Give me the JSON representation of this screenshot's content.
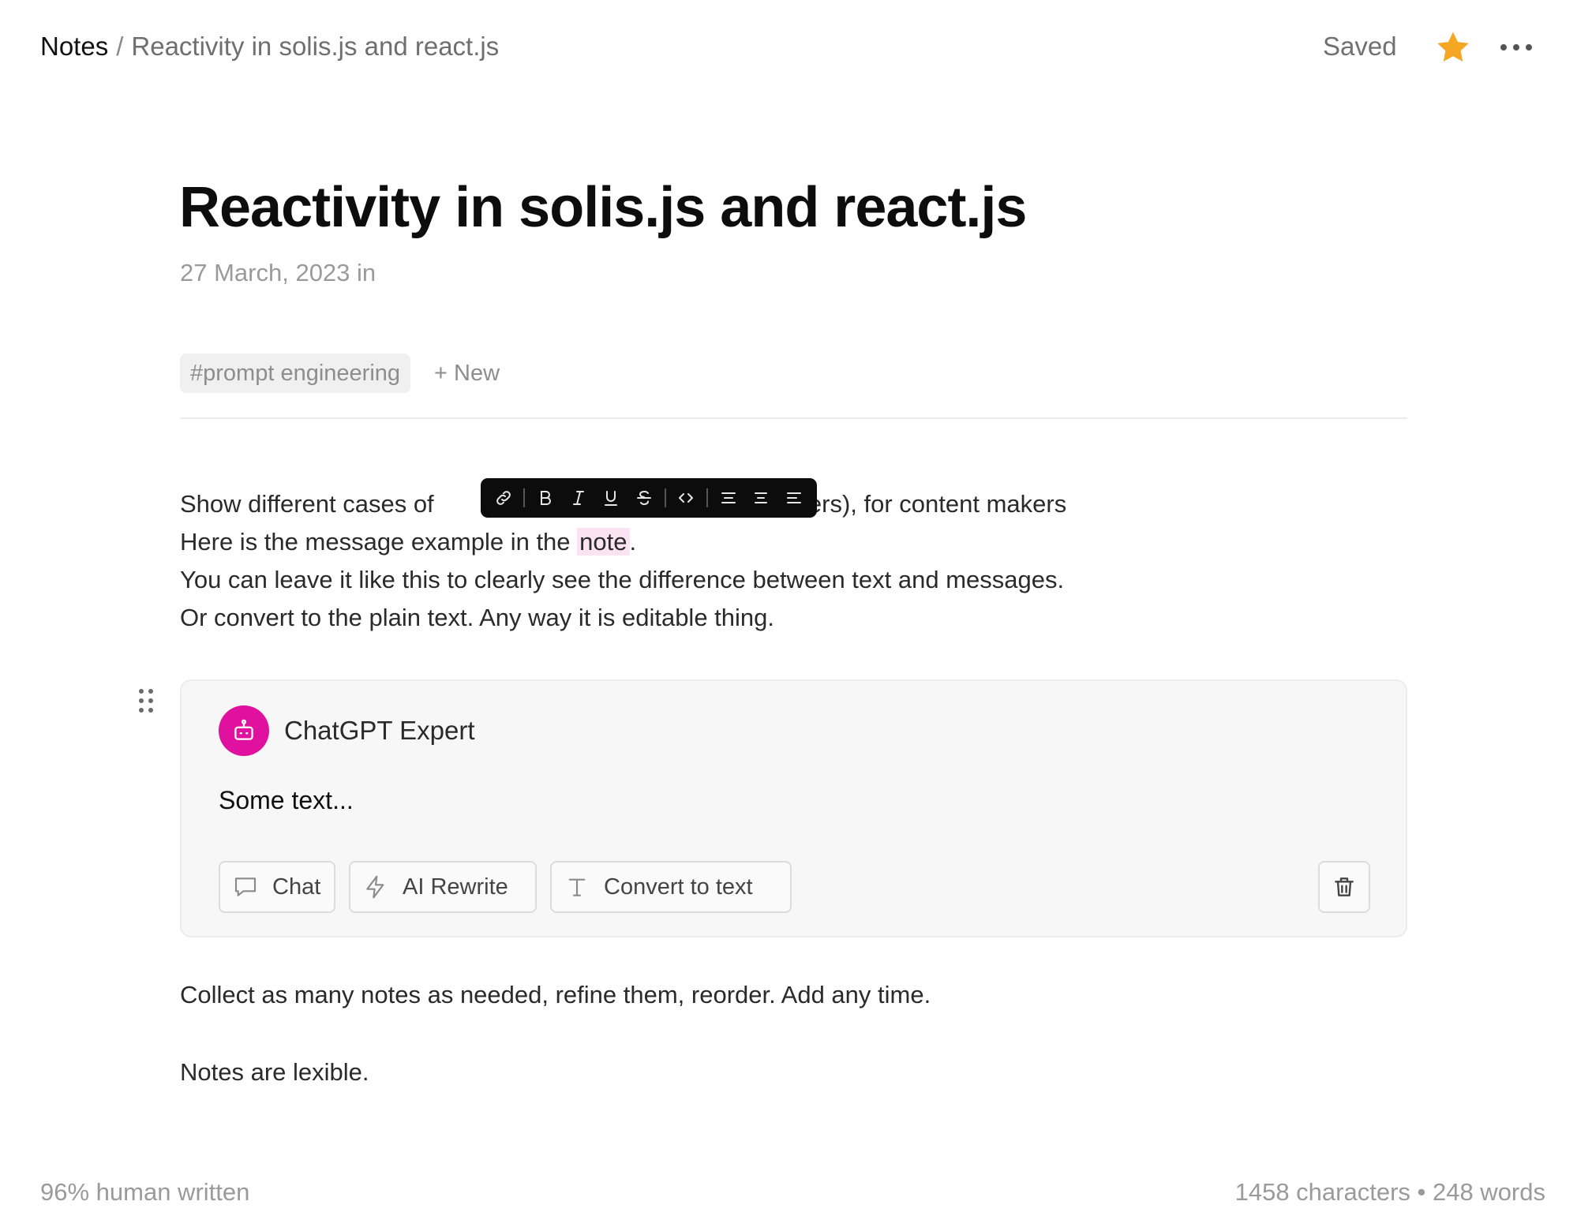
{
  "breadcrumb": {
    "root": "Notes",
    "separator": "/",
    "current": "Reactivity in solis.js and react.js"
  },
  "header": {
    "status": "Saved"
  },
  "note": {
    "title": "Reactivity in solis.js and react.js",
    "meta": "27 March, 2023 in",
    "tags": [
      "#prompt engineering"
    ],
    "new_tag_label": "+ New",
    "paragraph": {
      "line1_start": "Show different cases of",
      "line1_end": "writers), for content makers",
      "line2_before": "Here is the message example in the ",
      "line2_highlight": "note",
      "line2_after": ".",
      "line3": "You can leave it like this to clearly see the difference between text and messages.",
      "line4": "Or convert to the plain text. Any way it is editable thing."
    },
    "after_card": "Collect as many notes as needed, refine them, reorder. Add any time.",
    "closing": "Notes are lexible."
  },
  "toolbar": {
    "items": [
      "link-icon",
      "bold-icon",
      "italic-icon",
      "underline-icon",
      "strikethrough-icon",
      "code-icon",
      "align-center-icon",
      "align-justify-icon",
      "align-left-icon"
    ]
  },
  "message_card": {
    "author": "ChatGPT Expert",
    "text": "Some text...",
    "avatar_color": "#e0119e",
    "actions": {
      "chat": "Chat",
      "rewrite": "AI Rewrite",
      "convert": "Convert to text"
    }
  },
  "footer": {
    "human_written": "96% human written",
    "stats": "1458 characters • 248 words"
  },
  "colors": {
    "accent": "#e0119e",
    "star": "#f5a623",
    "highlight": "#fbe3f1"
  }
}
